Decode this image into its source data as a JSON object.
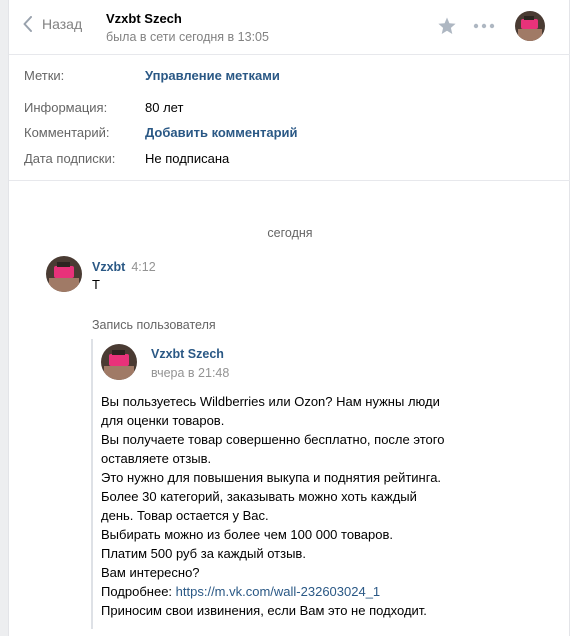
{
  "header": {
    "back_label": "Назад",
    "peer_name": "Vzxbt Szech",
    "peer_status": "была в сети сегодня в 13:05"
  },
  "info": {
    "tags_label": "Метки:",
    "tags_value": "Управление метками",
    "info_label": "Информация:",
    "info_value": "80 лет",
    "comment_label": "Комментарий:",
    "comment_value": "Добавить комментарий",
    "subscribe_label": "Дата подписки:",
    "subscribe_value": "Не подписана"
  },
  "messages": {
    "date_separator": "сегодня",
    "message": {
      "author": "Vzxbt",
      "time": "4:12",
      "text": "Т"
    },
    "repost_label": "Запись пользователя",
    "post": {
      "author": "Vzxbt Szech",
      "when": "вчера в 21:48",
      "lines": [
        "Вы пользуетесь Wildberries или Ozon? Нам нужны люди",
        "для оценки товаров.",
        "Вы получаете товар совершенно бесплатно, после этого",
        "оставляете отзыв.",
        "Это нужно для повышения выкупа и поднятия рейтинга.",
        "Более 30 категорий, заказывать можно хоть каждый",
        "день. Товар остается у Вас.",
        "Выбирать можно из более чем 100 000 товаров.",
        "Платим 500 руб за каждый отзыв.",
        "Вам интересно?"
      ],
      "more_prefix": "Подробнее: ",
      "more_link": "https://m.vk.com/wall-232603024_1",
      "last_line": "Приносим свои извинения, если Вам это не подходит."
    }
  },
  "colors": {
    "link": "#2a5885",
    "muted": "#828282",
    "avatar_accent": "#e8327a"
  },
  "icons": [
    "chevron-left-icon",
    "star-icon",
    "more-dots-icon"
  ]
}
